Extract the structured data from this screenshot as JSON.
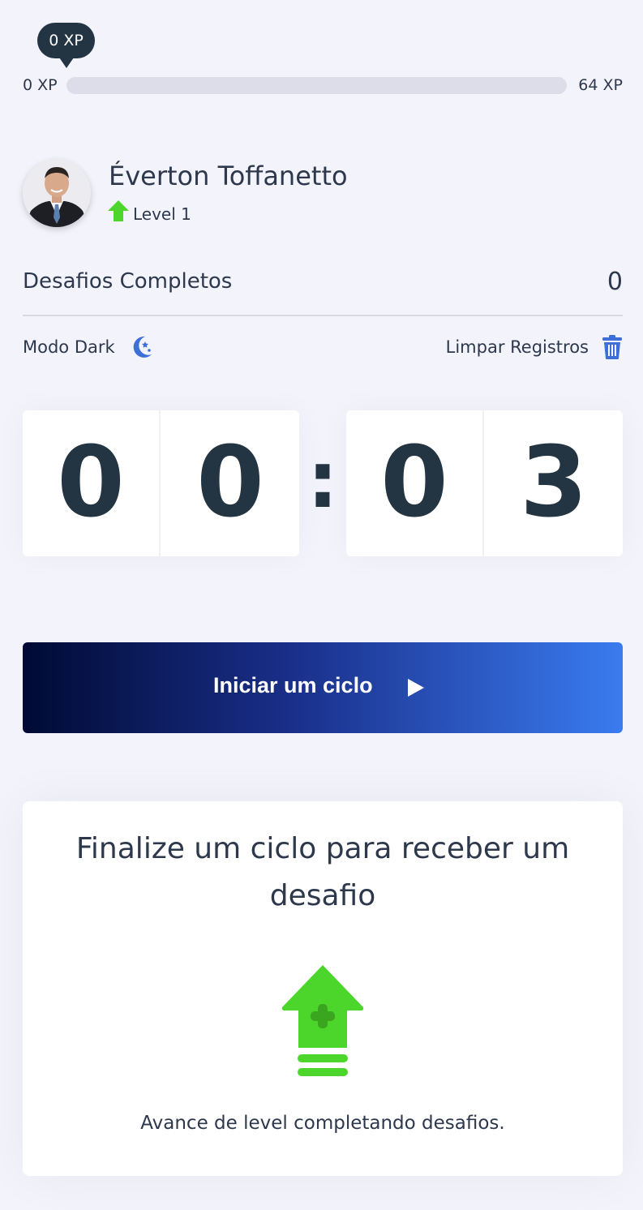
{
  "experience": {
    "current_bubble": "0 XP",
    "min_label": "0 XP",
    "max_label": "64 XP",
    "progress_fraction": 0
  },
  "profile": {
    "name": "Éverton Toffanetto",
    "level": "Level 1",
    "level_icon": "level-up-arrow-icon"
  },
  "stats": {
    "completed_label": "Desafios Completos",
    "completed_value": "0"
  },
  "options": {
    "dark_mode_label": "Modo Dark",
    "dark_mode_icon": "moon-stars-icon",
    "clear_label": "Limpar Registros",
    "clear_icon": "trash-icon"
  },
  "countdown": {
    "minute_left": "0",
    "minute_right": "0",
    "separator": ":",
    "second_left": "0",
    "second_right": "3"
  },
  "start_button": {
    "label": "Iniciar um ciclo",
    "icon": "play-icon"
  },
  "challenge": {
    "title": "Finalize um ciclo para receber um desafio",
    "icon": "level-up-icon",
    "text": "Avance de level completando desafios."
  },
  "colors": {
    "background": "#f2f3fb",
    "text": "#2e384d",
    "dark": "#233443",
    "green": "#4cd62b",
    "accent_blue": "#3a7bef"
  }
}
